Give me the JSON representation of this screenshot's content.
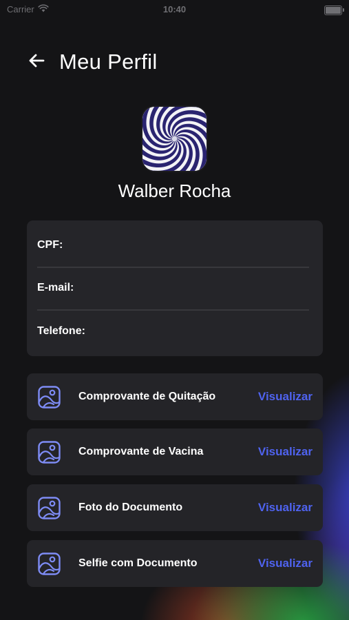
{
  "status_bar": {
    "carrier": "Carrier",
    "time": "10:40"
  },
  "header": {
    "back_icon": "arrow-left-icon",
    "title": "Meu Perfil"
  },
  "profile": {
    "avatar_icon": "swirl-avatar",
    "name": "Walber Rocha"
  },
  "info": {
    "cpf_label": "CPF:",
    "email_label": "E-mail:",
    "phone_label": "Telefone:"
  },
  "documents": [
    {
      "title": "Comprovante de Quitação",
      "action": "Visualizar",
      "icon": "image-icon"
    },
    {
      "title": "Comprovante de Vacina",
      "action": "Visualizar",
      "icon": "image-icon"
    },
    {
      "title": "Foto do Documento",
      "action": "Visualizar",
      "icon": "image-icon"
    },
    {
      "title": "Selfie com Documento",
      "action": "Visualizar",
      "icon": "image-icon"
    }
  ],
  "colors": {
    "background": "#141416",
    "card": "#252529",
    "accent": "#4f63f0",
    "icon": "#7e8cf5"
  }
}
